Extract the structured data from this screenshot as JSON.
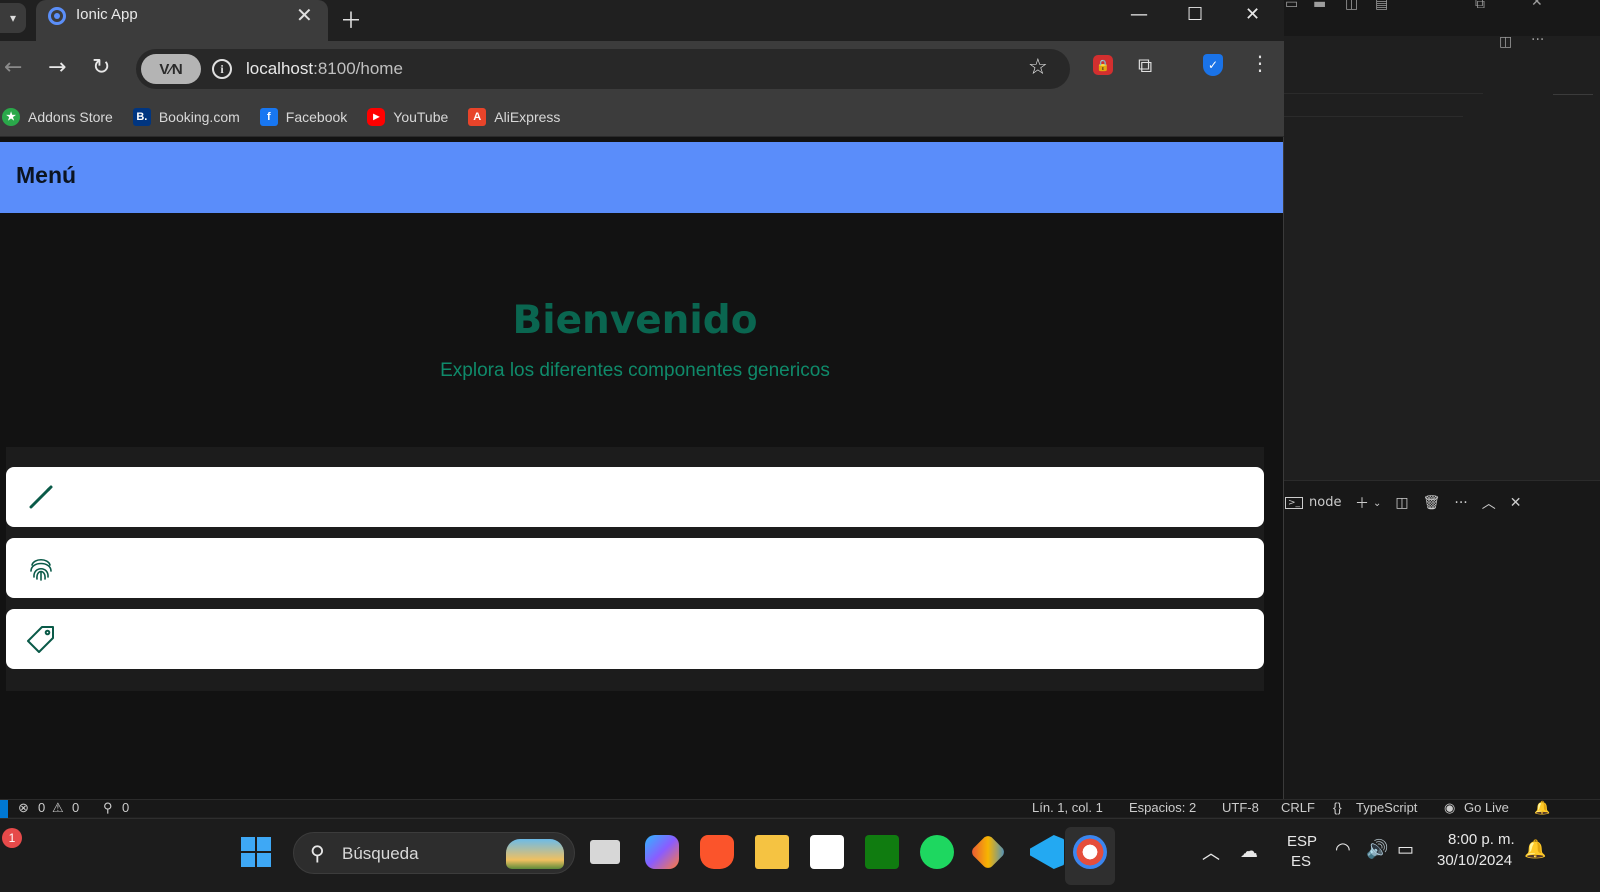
{
  "browser": {
    "tab_title": "Ionic App",
    "url_host": "localhost",
    "url_rest": ":8100/home",
    "vpn_label": "V⁄N",
    "bookmarks": [
      {
        "label": "Addons Store",
        "color": "#2aa84a",
        "glyph": "★"
      },
      {
        "label": "Booking.com",
        "color": "#003580",
        "glyph": "B."
      },
      {
        "label": "Facebook",
        "color": "#1877f2",
        "glyph": "f"
      },
      {
        "label": "YouTube",
        "color": "#ff0000",
        "glyph": "▶"
      },
      {
        "label": "AliExpress",
        "color": "#e8442a",
        "glyph": "A"
      }
    ]
  },
  "app": {
    "header_title": "Menú",
    "hero_title": "Bienvenido",
    "hero_subtitle": "Explora los diferentes componentes genericos",
    "items": [
      {
        "icon": "pencil-icon"
      },
      {
        "icon": "fingerprint-icon"
      },
      {
        "icon": "pricetag-icon"
      }
    ],
    "colors": {
      "header": "#5a8dfa",
      "accent": "#0a6650",
      "background": "#121212"
    }
  },
  "vscode": {
    "terminal_tab": "node",
    "status": {
      "errors": "0",
      "warnings": "0",
      "ports": "0",
      "position": "Lín. 1, col. 1",
      "spaces": "Espacios: 2",
      "encoding": "UTF-8",
      "eol": "CRLF",
      "language": "TypeScript",
      "golive": "Go Live"
    }
  },
  "taskbar": {
    "search_placeholder": "Búsqueda",
    "lang_top": "ESP",
    "lang_bottom": "ES",
    "time": "8:00 p. m.",
    "date": "30/10/2024",
    "notification_badge": "1"
  }
}
